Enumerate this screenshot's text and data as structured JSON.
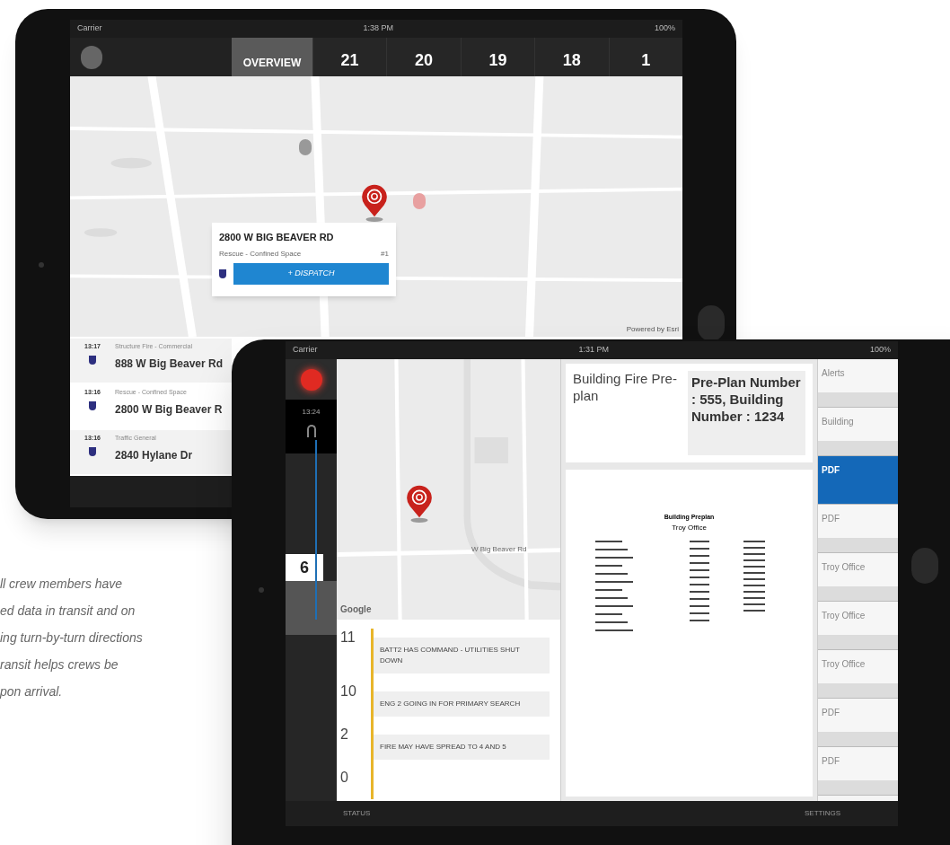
{
  "caption": {
    "lines": [
      "ll crew members have",
      "ed data in transit and on",
      "ing turn-by-turn directions",
      "ransit helps crews be",
      "pon arrival."
    ]
  },
  "tablet_back": {
    "status_bar": {
      "carrier": "Carrier",
      "time": "1:38 PM",
      "battery": "100%"
    },
    "tabs": [
      {
        "label": "OVERVIEW",
        "selected": true
      },
      {
        "label": "21",
        "selected": false
      },
      {
        "label": "20",
        "selected": false
      },
      {
        "label": "19",
        "selected": false
      },
      {
        "label": "18",
        "selected": false
      },
      {
        "label": "1",
        "selected": false
      }
    ],
    "map": {
      "card": {
        "address": "2800 W BIG BEAVER RD",
        "type": "Rescue - Confined Space",
        "number": "#1",
        "button": "+ DISPATCH"
      },
      "attribution": "Powered by Esri"
    },
    "incidents": [
      {
        "time": "13:17",
        "type": "Structure Fire - Commercial",
        "address": "888 W Big Beaver Rd"
      },
      {
        "time": "13:16",
        "type": "Rescue - Confined Space",
        "address": "2800 W Big Beaver R"
      },
      {
        "time": "13:16",
        "type": "Traffic General",
        "address": "2840 Hylane Dr"
      }
    ]
  },
  "tablet_front": {
    "status_bar": {
      "carrier": "Carrier",
      "time": "1:31 PM",
      "battery": "100%"
    },
    "sidebar": {
      "time": "13:24",
      "badge": "6"
    },
    "map": {
      "street": "W Big Beaver Rd",
      "attribution": "Google"
    },
    "log": [
      {
        "number": "11",
        "message": "BATT2 HAS COMMAND - UTILITIES SHUT DOWN"
      },
      {
        "number": "10",
        "message": "ENG 2 GOING IN FOR PRIMARY SEARCH"
      },
      {
        "number": "2",
        "message": "FIRE MAY HAVE SPREAD TO 4 AND 5"
      },
      {
        "number": "0"
      }
    ],
    "header": {
      "title": "Building Fire Pre-plan",
      "subtitle": "Pre-Plan Number : 555, Building Number : 1234"
    },
    "document": {
      "title": "Building Preplan",
      "subtitle": "Troy Office"
    },
    "files": [
      {
        "label": "Alerts",
        "selected": false
      },
      {
        "label": "Building",
        "selected": false
      },
      {
        "label": "PDF",
        "selected": true
      },
      {
        "label": "PDF",
        "selected": false
      },
      {
        "label": "Troy Office",
        "selected": false
      },
      {
        "label": "Troy Office",
        "selected": false
      },
      {
        "label": "Troy Office",
        "selected": false
      },
      {
        "label": "PDF",
        "selected": false
      },
      {
        "label": "PDF",
        "selected": false
      }
    ],
    "nav": [
      "STATUS",
      "SETTINGS"
    ]
  }
}
